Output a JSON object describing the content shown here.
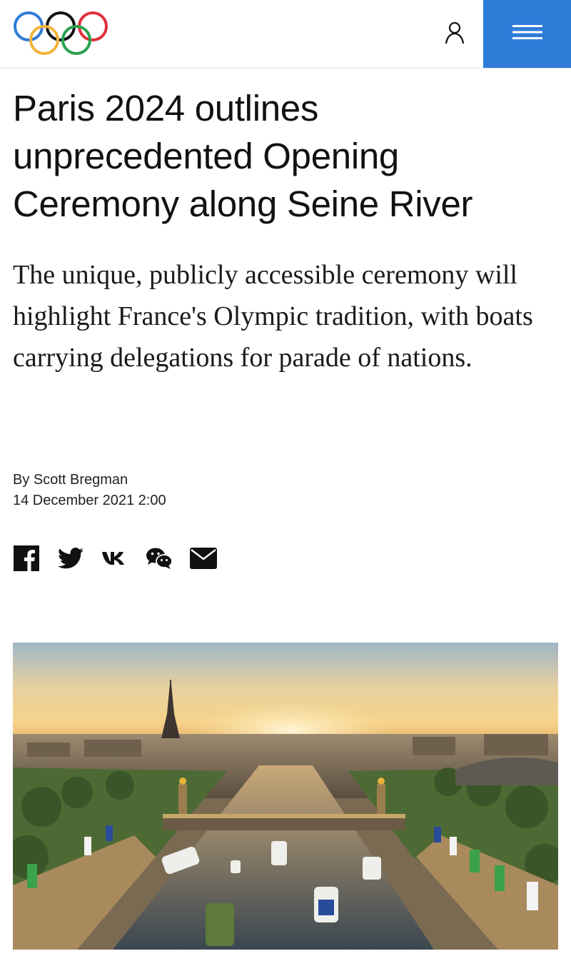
{
  "header": {
    "logo_icon": "olympic-rings-icon",
    "account_icon": "user-icon",
    "menu_icon": "hamburger-menu-icon",
    "menu_color": "#2f7bd8",
    "ring_colors": [
      "#2f7bd8",
      "#111111",
      "#e0303c",
      "#f2b33d",
      "#2aa150"
    ]
  },
  "article": {
    "title": "Paris 2024 outlines unprecedented Opening Ceremony along Seine River",
    "subtitle": "The unique, publicly accessible ceremony will highlight France's Olympic tradition, with boats carrying delegations for parade of nations.",
    "author": "By Scott Bregman",
    "date": "14 December 2021 2:00"
  },
  "share": {
    "icons": [
      "facebook-icon",
      "twitter-icon",
      "vk-icon",
      "wechat-icon",
      "email-icon"
    ]
  },
  "hero_image": {
    "subject": "eiffel-tower-seine-river-illustration"
  }
}
